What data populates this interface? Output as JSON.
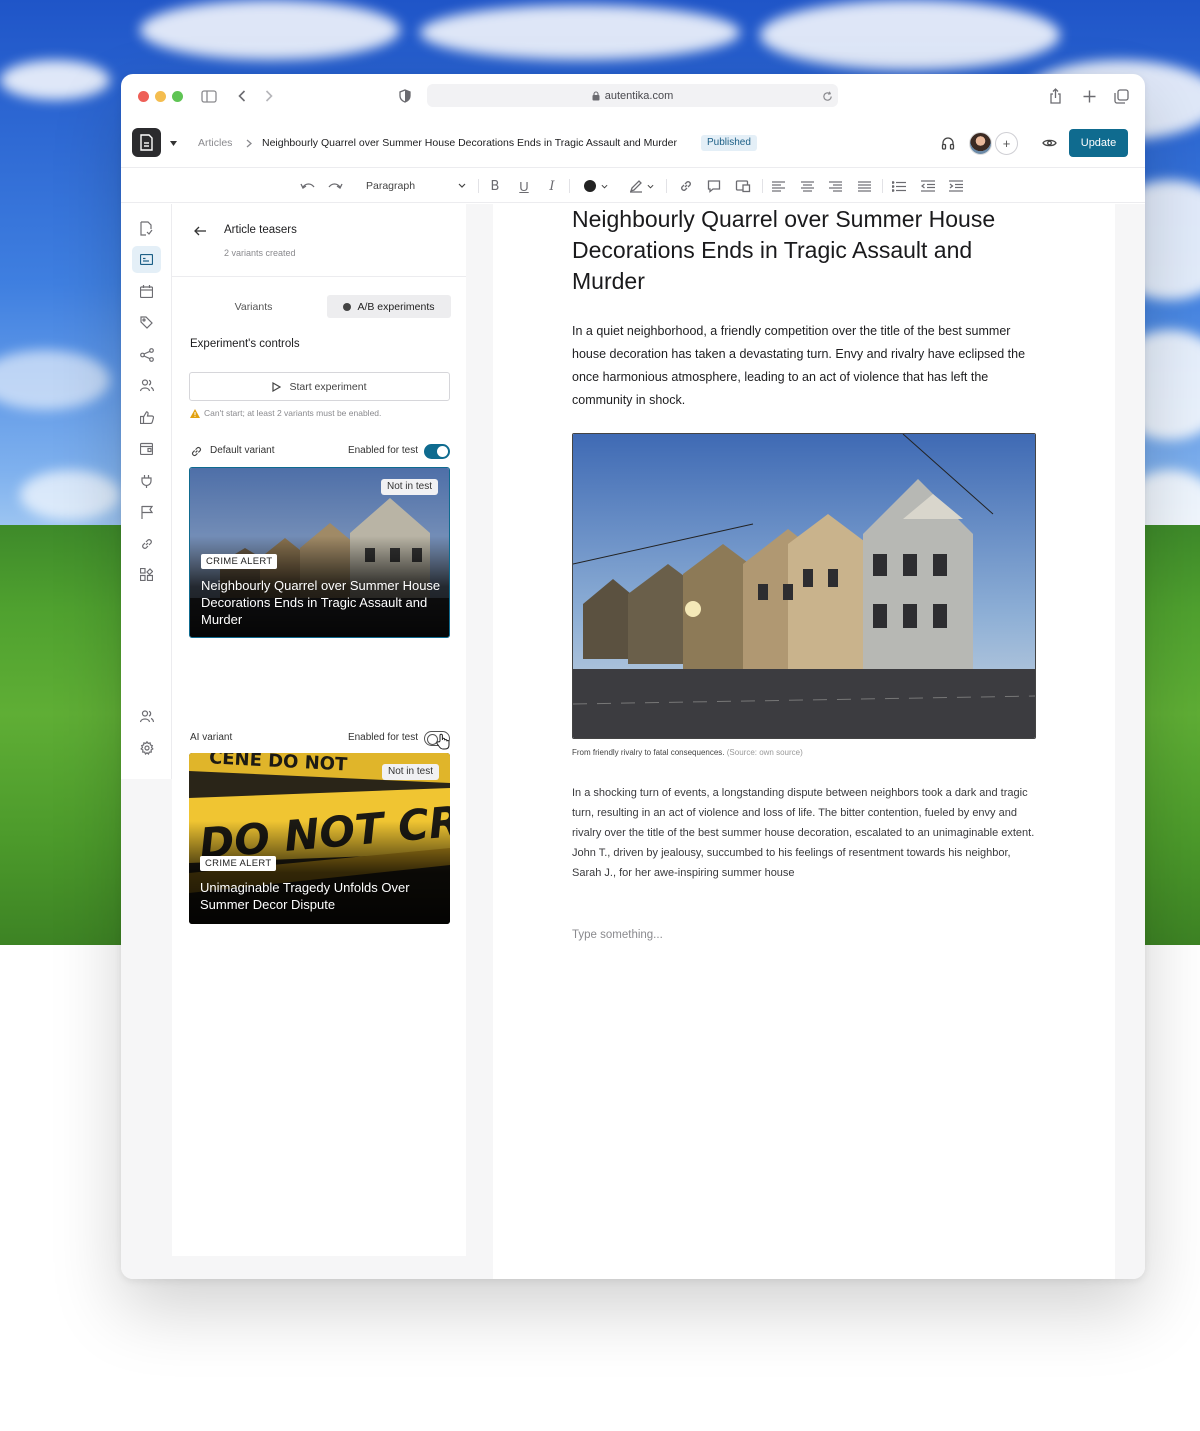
{
  "browser": {
    "url": "autentika.com"
  },
  "appbar": {
    "breadcrumb_root": "Articles",
    "breadcrumb_current": "Neighbourly Quarrel over Summer House Decorations Ends in Tragic Assault and Murder",
    "status_badge": "Published",
    "update_label": "Update",
    "add_collaborator": "+"
  },
  "toolbar": {
    "paragraph_style": "Paragraph"
  },
  "panel": {
    "title": "Article teasers",
    "subtitle": "2 variants created",
    "tabs": [
      "Variants",
      "A/B experiments"
    ],
    "controls_title": "Experiment's controls",
    "start_label": "Start experiment",
    "warning": "Can't start; at least 2 variants must be enabled.",
    "default_variant": {
      "label": "Default variant",
      "toggle_label": "Enabled for test",
      "enabled": true,
      "badge": "Not in test",
      "tag": "CRIME ALERT",
      "title": "Neighbourly Quarrel over Summer House Decorations Ends in Tragic Assault and Murder"
    },
    "ai_variant": {
      "label": "AI variant",
      "toggle_label": "Enabled for test",
      "enabled": false,
      "badge": "Not in test",
      "tag": "CRIME ALERT",
      "title": "Unimaginable Tragedy Unfolds Over Summer Decor Dispute"
    }
  },
  "article": {
    "title": "Neighbourly Quarrel over Summer House Decorations Ends in Tragic Assault and Murder",
    "lead": "In a quiet neighborhood, a friendly competition over the title of the best summer house decoration has taken a devastating turn. Envy and rivalry have eclipsed the once harmonious atmosphere, leading to an act of violence that has left the community in shock.",
    "caption": "From friendly rivalry to fatal consequences.",
    "caption_source": "(Source: own source)",
    "body": "In a shocking turn of events, a longstanding dispute between neighbors took a dark and tragic turn, resulting in an act of violence and loss of life. The bitter contention, fueled by envy and rivalry over the title of the best summer house decoration, escalated to an unimaginable extent. John T., driven by jealousy, succumbed to his feelings of resentment towards his neighbor, Sarah J., for her awe-inspiring summer house",
    "placeholder": "Type something..."
  },
  "colors": {
    "accent": "#0f6b8f",
    "badge_bg": "#e4eff7",
    "panel_bg": "#f6f6f7"
  }
}
